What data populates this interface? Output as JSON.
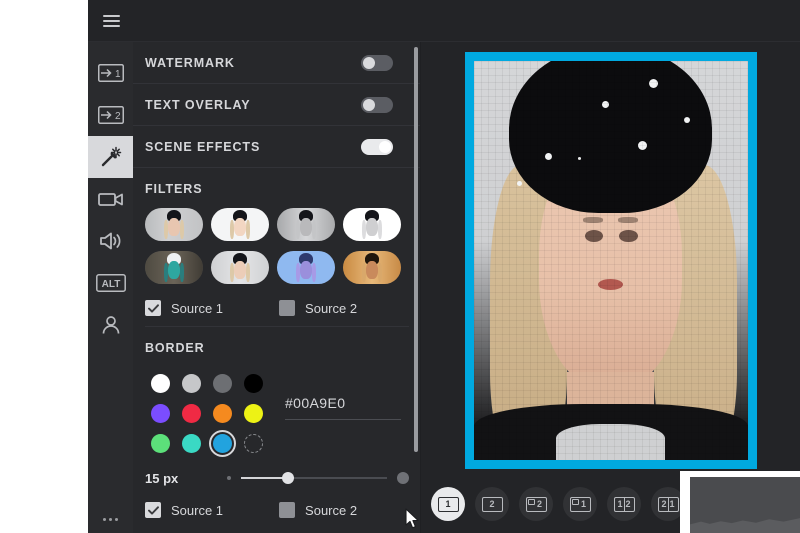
{
  "app": {
    "background": "#232427",
    "panel_background": "#27282b",
    "accent": "#00A9E0"
  },
  "topbar": {
    "menu_icon": "hamburger-icon"
  },
  "rail": {
    "items": [
      {
        "id": "source-1",
        "icon": "arrow-into-box-1-icon",
        "label": "1",
        "active": false
      },
      {
        "id": "source-2",
        "icon": "arrow-into-box-2-icon",
        "label": "2",
        "active": false
      },
      {
        "id": "effects",
        "icon": "magic-wand-icon",
        "label": "",
        "active": true
      },
      {
        "id": "camera",
        "icon": "video-camera-icon",
        "label": "",
        "active": false
      },
      {
        "id": "audio",
        "icon": "speaker-volume-icon",
        "label": "",
        "active": false
      },
      {
        "id": "alt",
        "icon": "alt-key-icon",
        "label": "ALT",
        "active": false
      },
      {
        "id": "account",
        "icon": "person-icon",
        "label": "",
        "active": false
      }
    ],
    "more_icon": "more-dots-icon"
  },
  "panel": {
    "toggles": [
      {
        "label": "WATERMARK",
        "on": false
      },
      {
        "label": "TEXT OVERLAY",
        "on": false
      },
      {
        "label": "SCENE EFFECTS",
        "on": true
      }
    ],
    "filters": {
      "title": "FILTERS",
      "thumbnails": [
        {
          "id": "filter-normal",
          "tint": "#b9bbbd",
          "face": "#e8c6b0",
          "selected": false
        },
        {
          "id": "filter-bright",
          "tint": "#f4f5f6",
          "face": "#f2d6c2",
          "selected": false
        },
        {
          "id": "filter-mono",
          "tint": "#a7a8aa",
          "face": "#b9b9bb",
          "selected": false
        },
        {
          "id": "filter-highcon",
          "tint": "#ffffff",
          "face": "#cfcfd1",
          "selected": false
        },
        {
          "id": "filter-negative",
          "tint": "#585146",
          "face": "#2ea7a0",
          "selected": false
        },
        {
          "id": "filter-soft",
          "tint": "#d7d8da",
          "face": "#eccdb8",
          "selected": false
        },
        {
          "id": "filter-blue",
          "tint": "#8fb9f0",
          "face": "#9a8fdc",
          "selected": false
        },
        {
          "id": "filter-sepia",
          "tint": "#d79b55",
          "face": "#c98a5c",
          "selected": false
        }
      ],
      "sources": [
        {
          "label": "Source 1",
          "checked": true
        },
        {
          "label": "Source 2",
          "checked": false
        }
      ]
    },
    "border": {
      "title": "BORDER",
      "swatches": [
        {
          "color": "#ffffff",
          "selected": false
        },
        {
          "color": "#c6c7c9",
          "selected": false
        },
        {
          "color": "#6d6f73",
          "selected": false
        },
        {
          "color": "#000000",
          "selected": false
        },
        {
          "color": "#7b4dff",
          "selected": false
        },
        {
          "color": "#f02a44",
          "selected": false
        },
        {
          "color": "#f58a1f",
          "selected": false
        },
        {
          "color": "#edf215",
          "selected": false
        },
        {
          "color": "#5ce07a",
          "selected": false
        },
        {
          "color": "#3ad9c4",
          "selected": false
        },
        {
          "color": "#22a3de",
          "selected": true
        },
        {
          "color": "custom",
          "selected": false
        }
      ],
      "hex_value": "#00A9E0",
      "thickness_value": "15 px",
      "thickness_percent": 32,
      "sources": [
        {
          "label": "Source 1",
          "checked": true
        },
        {
          "label": "Source 2",
          "checked": false
        }
      ]
    },
    "scrollbar": {
      "visible": true
    }
  },
  "stage": {
    "preview": {
      "border_color": "#00A9E0",
      "border_width_px": 9
    },
    "layout_buttons": [
      {
        "id": "layout-single",
        "icon": "layout-1-icon",
        "label": "1",
        "active": true,
        "sub": false,
        "split": false
      },
      {
        "id": "layout-second",
        "icon": "layout-2-icon",
        "label": "2",
        "active": false,
        "sub": false,
        "split": false
      },
      {
        "id": "layout-pip-2",
        "icon": "layout-pip-2-icon",
        "label": "2",
        "active": false,
        "sub": true,
        "split": false
      },
      {
        "id": "layout-pip-1",
        "icon": "layout-pip-1-icon",
        "label": "1",
        "active": false,
        "sub": true,
        "split": false
      },
      {
        "id": "layout-split-1-2",
        "icon": "layout-split-icon",
        "label": "",
        "active": false,
        "sub": false,
        "split": true
      },
      {
        "id": "layout-split-2-1",
        "icon": "layout-split-2-icon",
        "label": "",
        "active": false,
        "sub": false,
        "split": true
      }
    ]
  },
  "popup": {
    "name": "bottom-right-overlay"
  },
  "cursor": {
    "name": "mouse-pointer"
  }
}
